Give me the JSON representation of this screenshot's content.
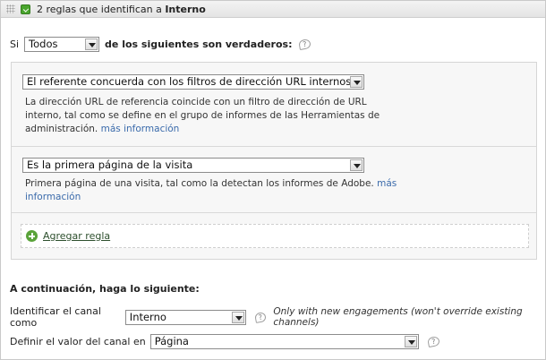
{
  "header": {
    "title_prefix": "2 reglas que identifican a",
    "title_name": "Interno"
  },
  "condition": {
    "if_label": "Si",
    "match_value": "Todos",
    "suffix": "de los siguientes son verdaderos:",
    "help": "?"
  },
  "rules": [
    {
      "select_value": "El referente concuerda con los filtros de dirección URL internos",
      "desc_lines": [
        "La dirección URL de referencia coincide con un filtro de dirección de URL",
        "interno, tal como se define en el grupo de informes de las Herramientas de",
        "administración."
      ],
      "more_link": "más información"
    },
    {
      "select_value": "Es la primera página de la visita",
      "desc_line1": "Primera página de una visita, tal como la detectan los informes de Adobe.",
      "more_link_part1": "más",
      "more_link_part2": "información"
    }
  ],
  "add_rule": {
    "label": "Agregar regla"
  },
  "then_section": {
    "title": "A continuación, haga lo siguiente:",
    "identify_label": "Identificar el canal como",
    "identify_value": "Interno",
    "identify_note": "Only with new engagements (won't override existing channels)",
    "define_label": "Definir el valor del canal en",
    "define_value": "Página"
  }
}
